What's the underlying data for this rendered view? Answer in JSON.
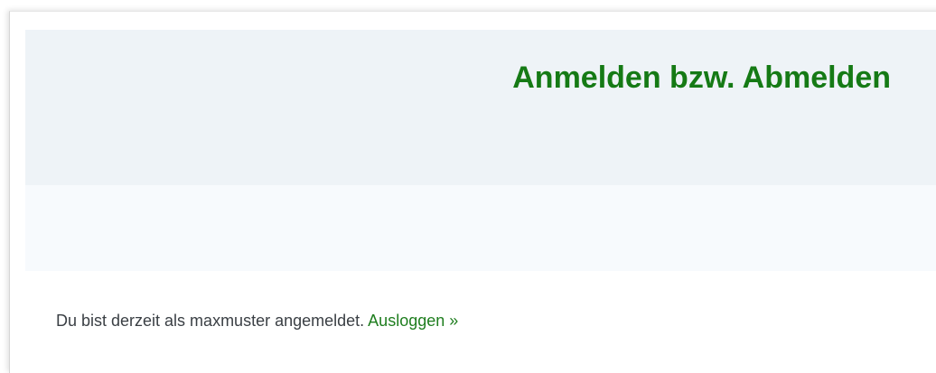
{
  "header": {
    "title": "Anmelden bzw. Abmelden"
  },
  "status": {
    "message": "Du bist derzeit als maxmuster angemeldet.",
    "logout_label": "Ausloggen »"
  },
  "colors": {
    "accent_green": "#157a15",
    "header_band": "#eef3f7",
    "sub_band": "#f7fafd",
    "body_text": "#3a3f44"
  }
}
